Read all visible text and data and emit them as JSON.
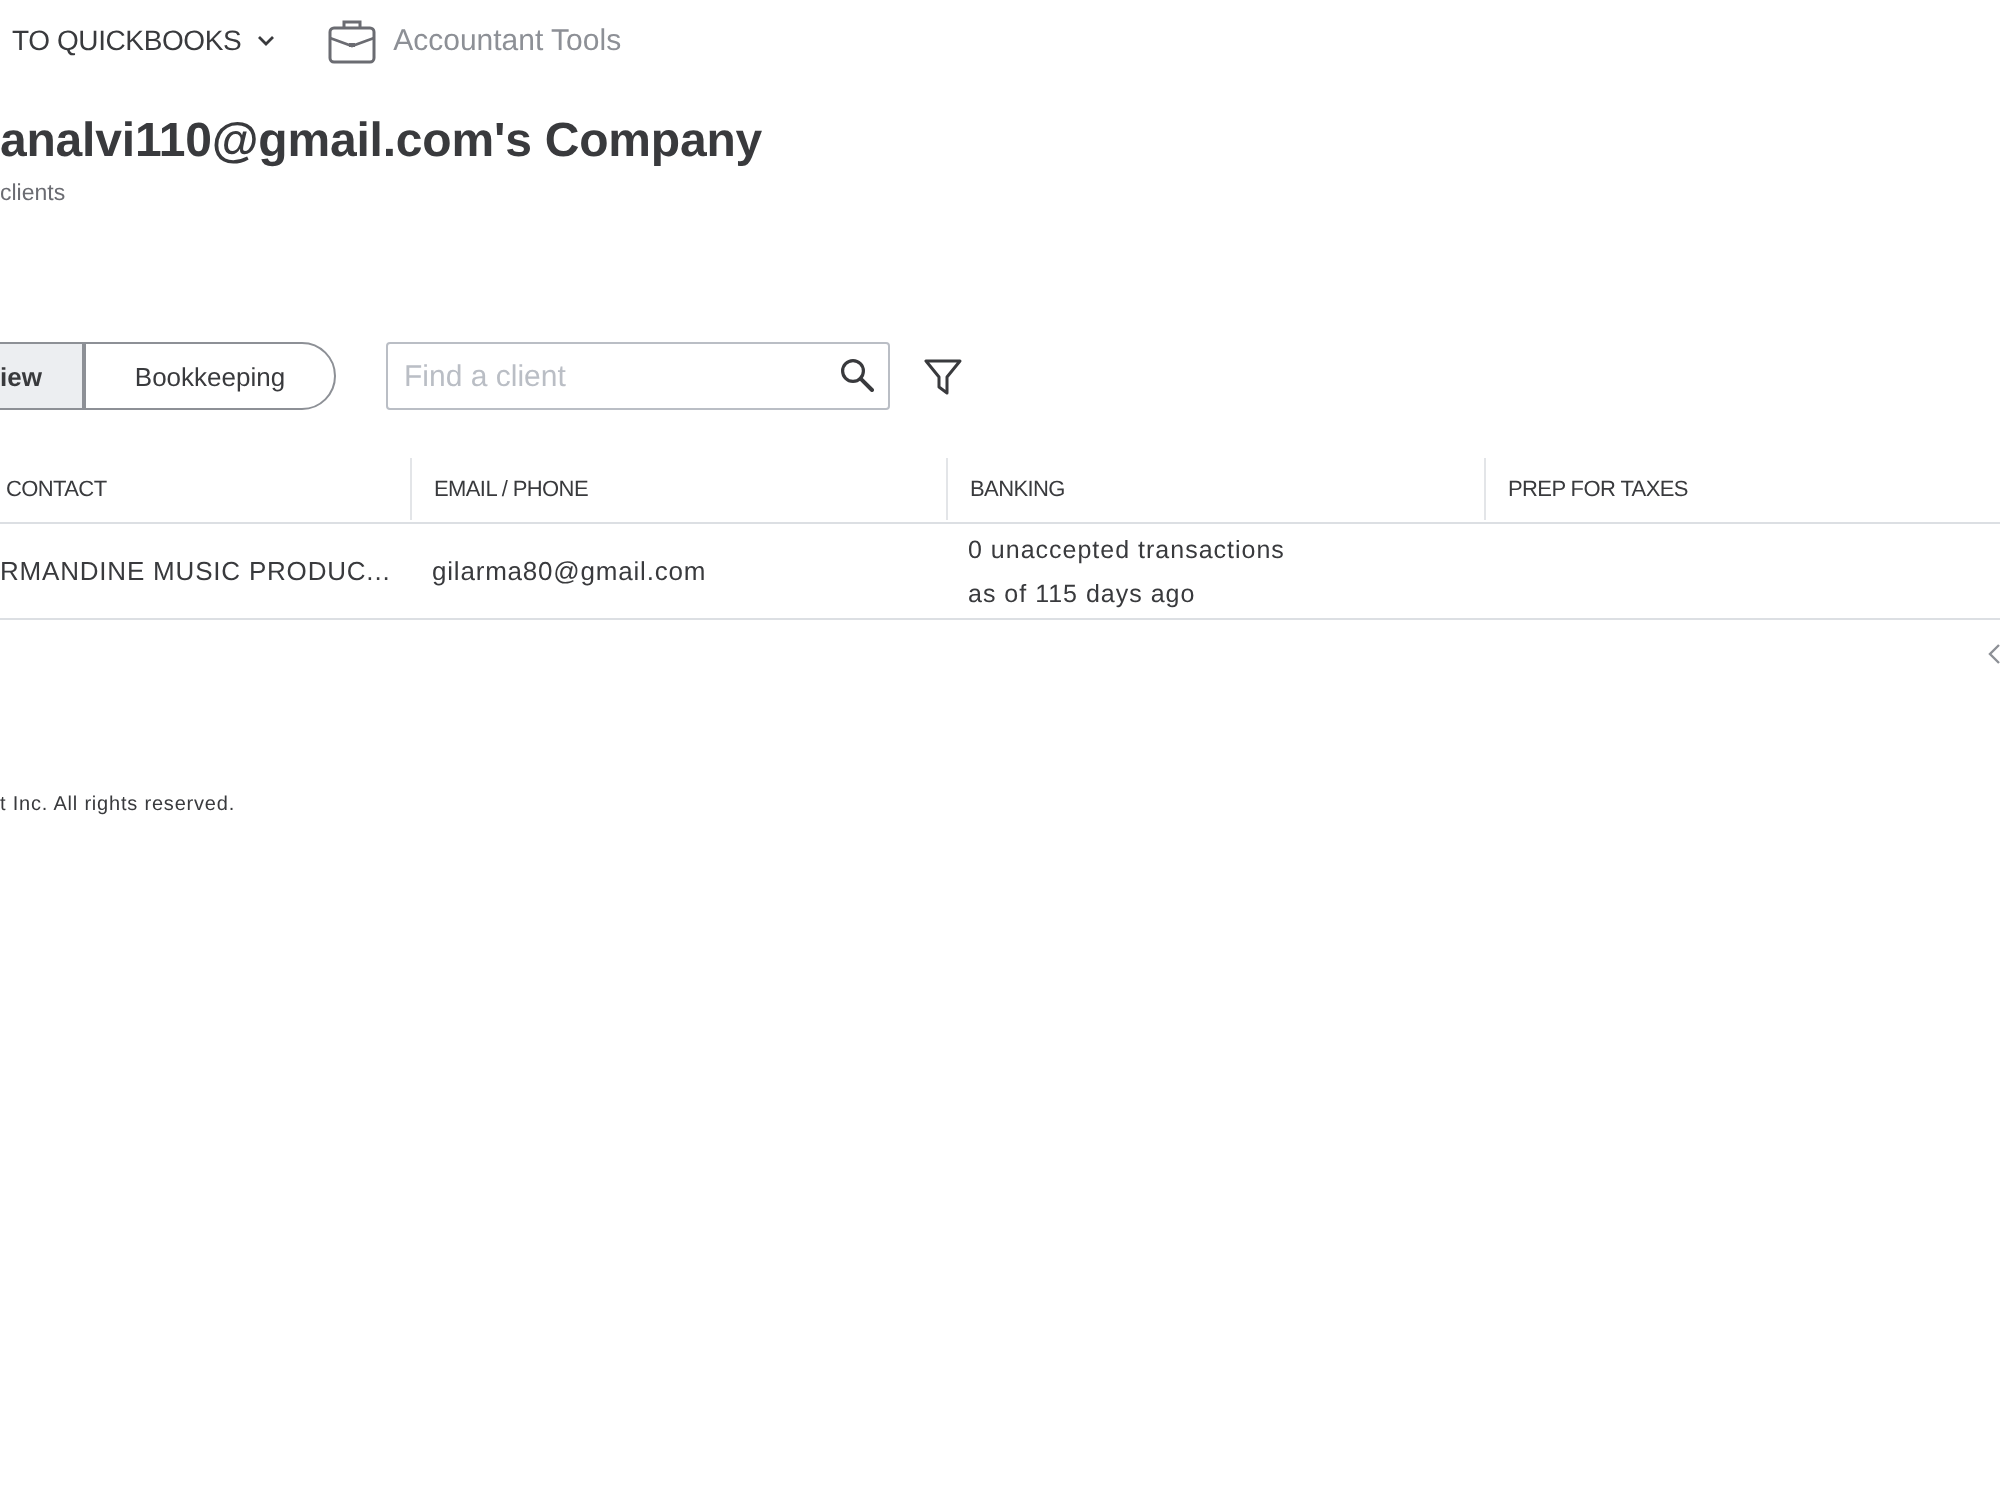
{
  "top_bar": {
    "back_link": "TO QUICKBOOKS",
    "tools_link": "Accountant Tools"
  },
  "header": {
    "title": "analvi110@gmail.com's Company",
    "subtitle": "clients"
  },
  "view_toggle": [
    {
      "label": "iew",
      "selected": true
    },
    {
      "label": "Bookkeeping",
      "selected": false
    }
  ],
  "search": {
    "placeholder": "Find a client"
  },
  "table": {
    "columns": [
      "CONTACT",
      "EMAIL / PHONE",
      "BANKING",
      "PREP FOR TAXES"
    ],
    "rows": [
      {
        "contact": "RMANDINE MUSIC PRODUC...",
        "email_phone": "gilarma80@gmail.com",
        "banking": {
          "status": "0 unaccepted transactions",
          "updated": "as of 115 days ago"
        }
      }
    ]
  },
  "footer": {
    "copyright": "t Inc. All rights reserved."
  }
}
